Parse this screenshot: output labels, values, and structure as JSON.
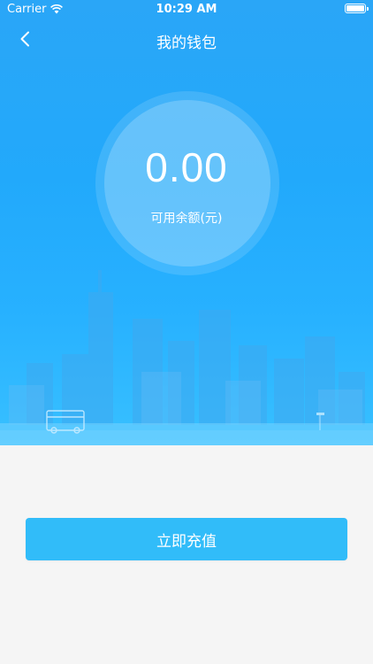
{
  "status_bar": {
    "carrier": "Carrier",
    "time": "10:29 AM",
    "icons": [
      "wifi-icon",
      "battery-icon"
    ]
  },
  "nav": {
    "back_icon": "chevron-left-icon",
    "title": "我的钱包"
  },
  "wallet": {
    "balance": "0.00",
    "balance_label": "可用余额(元)"
  },
  "actions": {
    "recharge_label": "立即充值"
  },
  "colors": {
    "accent": "#22a9fb",
    "button": "#31bcf9",
    "background": "#f5f5f5"
  }
}
